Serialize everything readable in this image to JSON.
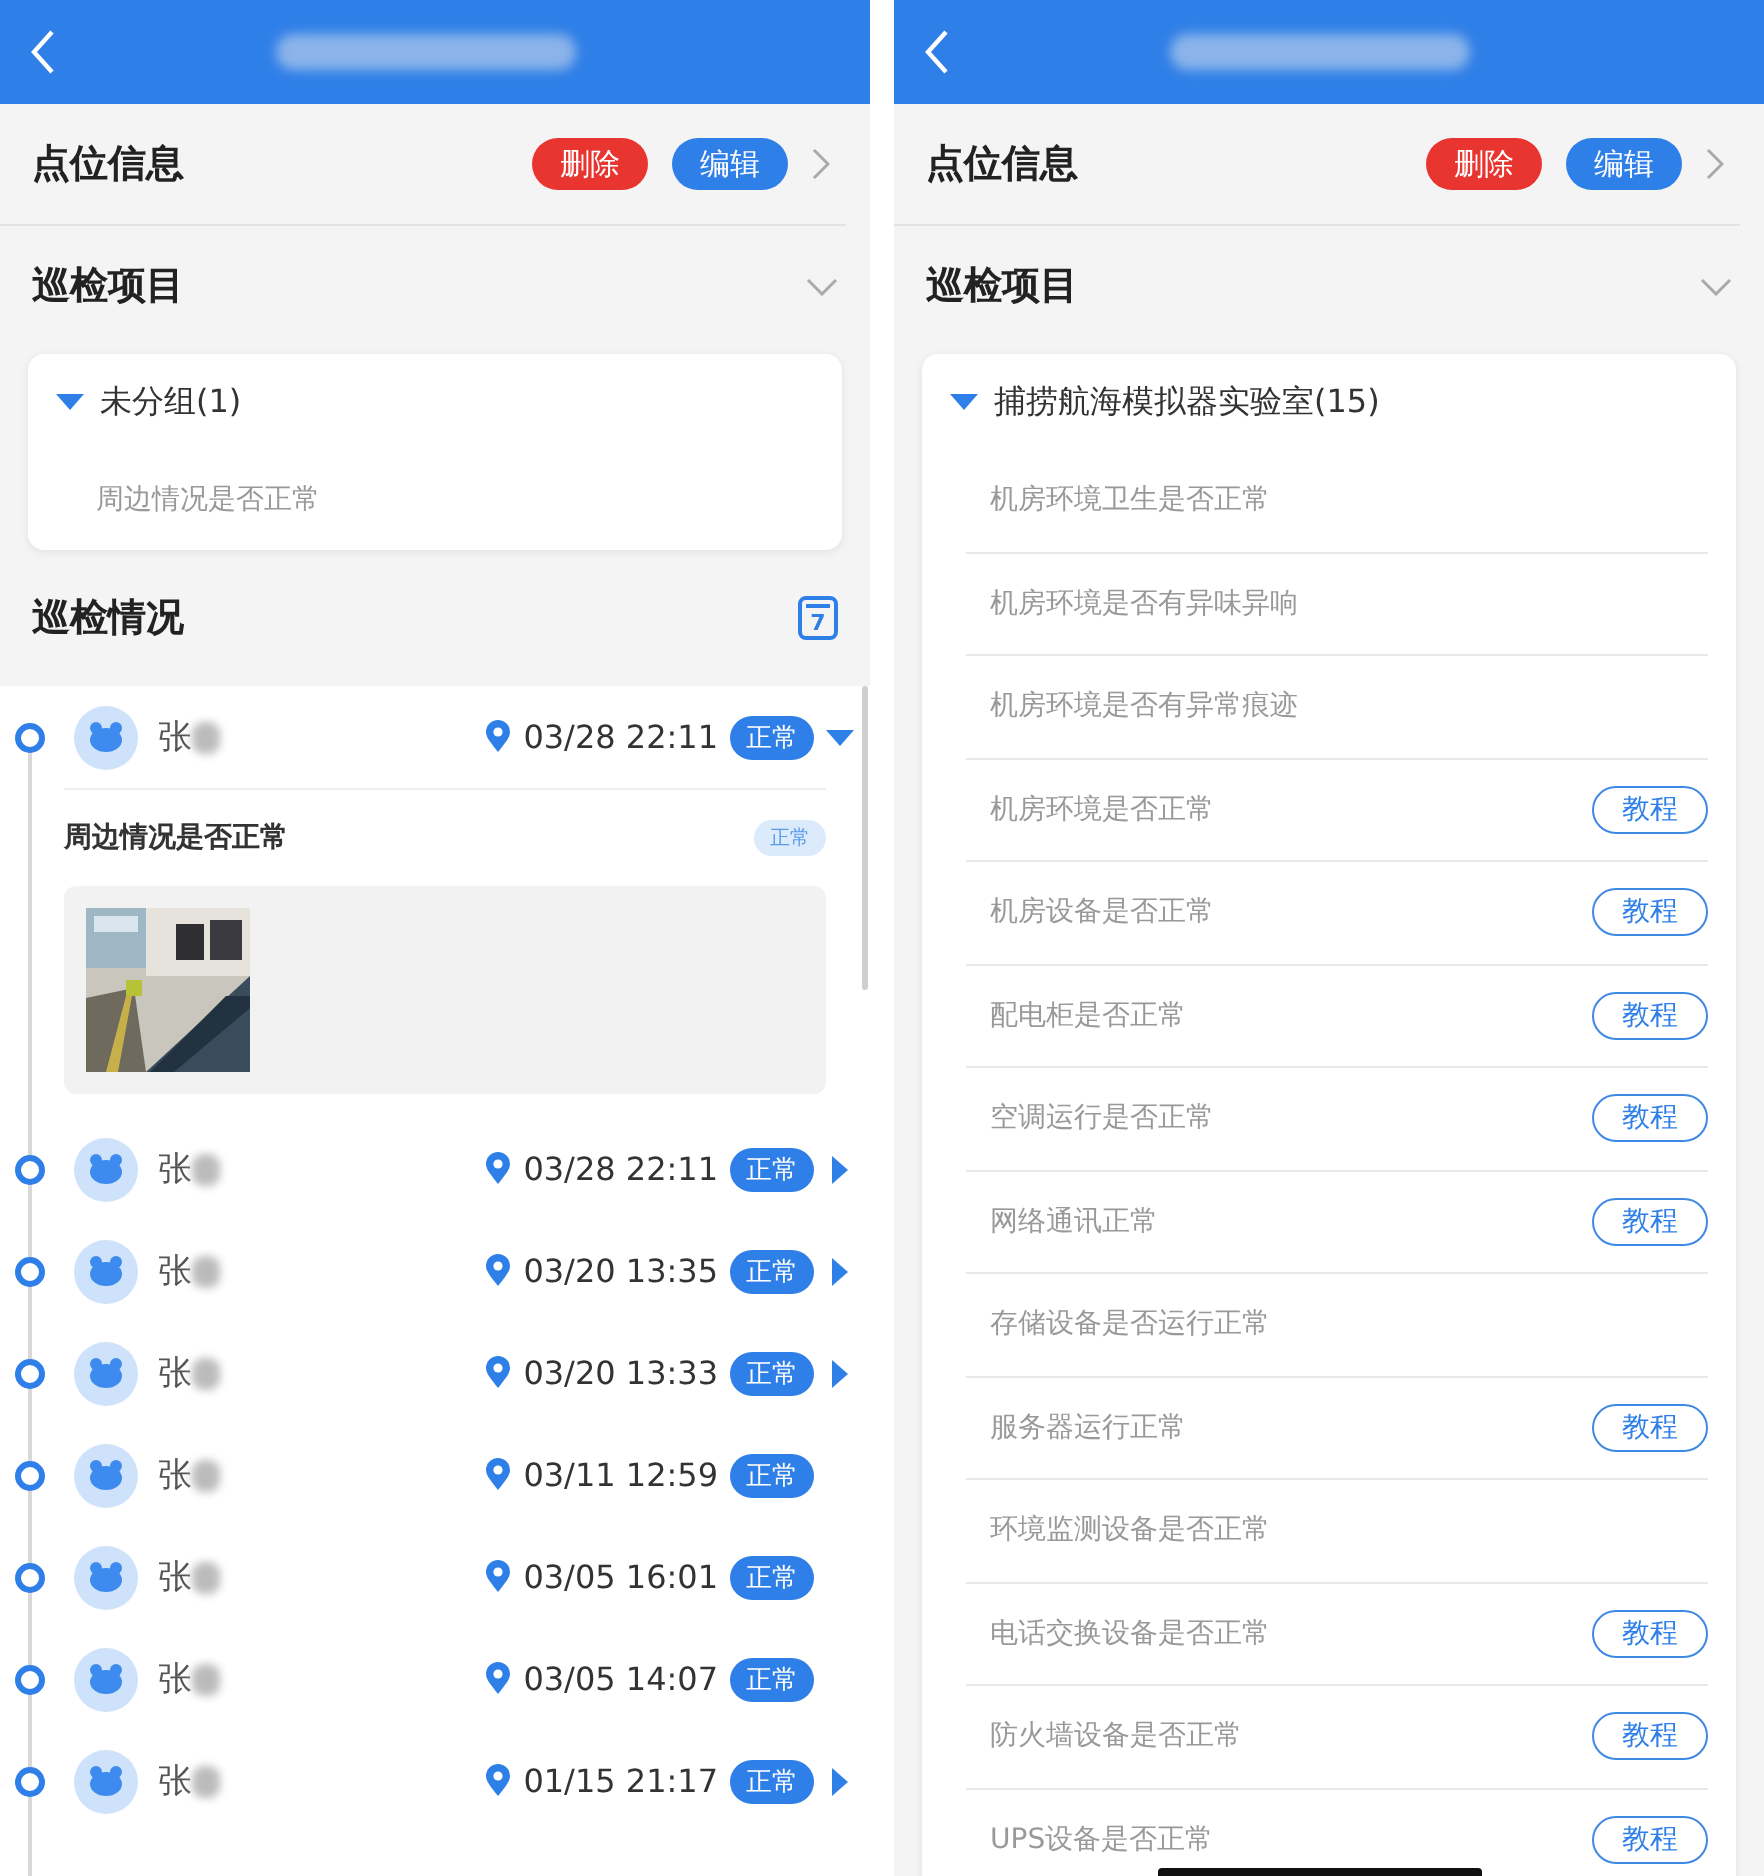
{
  "screens": [
    {
      "point_info": {
        "title": "点位信息",
        "delete": "删除",
        "edit": "编辑"
      },
      "items_section": {
        "title": "巡检项目",
        "group": {
          "name": "未分组(1)",
          "expanded": true,
          "items": [
            {
              "label": "周边情况是否正常"
            }
          ]
        }
      },
      "records_section": {
        "title": "巡检情况",
        "calendar_day": "7",
        "records": [
          {
            "name": "张",
            "location": true,
            "time": "03/28 22:11",
            "status": "正常",
            "expanded": true,
            "details": [
              {
                "label": "周边情况是否正常",
                "status": "正常"
              }
            ]
          },
          {
            "name": "张",
            "location": true,
            "time": "03/28 22:11",
            "status": "正常",
            "expanded": false
          },
          {
            "name": "张",
            "location": true,
            "time": "03/20 13:35",
            "status": "正常",
            "expanded": false
          },
          {
            "name": "张",
            "location": true,
            "time": "03/20 13:33",
            "status": "正常",
            "expanded": false
          },
          {
            "name": "张",
            "location": true,
            "time": "03/11 12:59",
            "status": "正常"
          },
          {
            "name": "张",
            "location": true,
            "time": "03/05 16:01",
            "status": "正常"
          },
          {
            "name": "张",
            "location": true,
            "time": "03/05 14:07",
            "status": "正常"
          },
          {
            "name": "张",
            "location": true,
            "time": "01/15 21:17",
            "status": "正常",
            "expanded": false
          }
        ]
      }
    },
    {
      "point_info": {
        "title": "点位信息",
        "delete": "删除",
        "edit": "编辑"
      },
      "items_section": {
        "title": "巡检项目",
        "group": {
          "name": "捕捞航海模拟器实验室(15)",
          "expanded": true,
          "items": [
            {
              "label": "机房环境卫生是否正常"
            },
            {
              "label": "机房环境是否有异味异响"
            },
            {
              "label": "机房环境是否有异常痕迹"
            },
            {
              "label": "机房环境是否正常",
              "tutorial": "教程"
            },
            {
              "label": "机房设备是否正常",
              "tutorial": "教程"
            },
            {
              "label": "配电柜是否正常",
              "tutorial": "教程"
            },
            {
              "label": "空调运行是否正常",
              "tutorial": "教程"
            },
            {
              "label": "网络通讯正常",
              "tutorial": "教程"
            },
            {
              "label": "存储设备是否运行正常"
            },
            {
              "label": "服务器运行正常",
              "tutorial": "教程"
            },
            {
              "label": "环境监测设备是否正常"
            },
            {
              "label": "电话交换设备是否正常",
              "tutorial": "教程"
            },
            {
              "label": "防火墙设备是否正常",
              "tutorial": "教程"
            },
            {
              "label": "UPS设备是否正常",
              "tutorial": "教程"
            }
          ]
        }
      }
    }
  ]
}
